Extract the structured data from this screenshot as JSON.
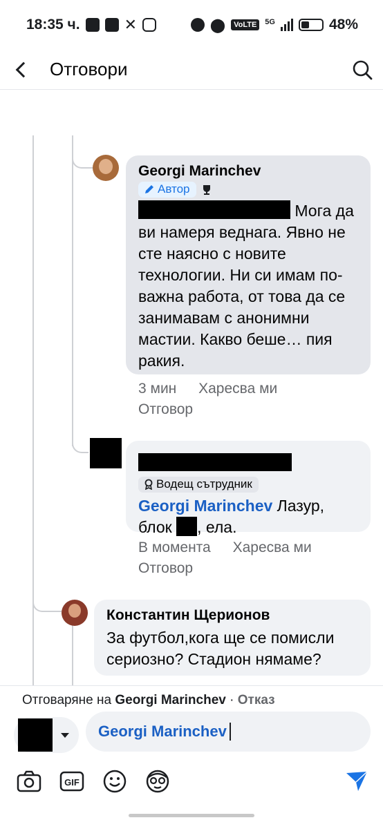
{
  "status_bar": {
    "time": "18:35 ч.",
    "network": "5G",
    "volte": "VoLTE",
    "battery": "48%"
  },
  "header": {
    "title": "Отговори"
  },
  "comments": [
    {
      "author": "Georgi Marinchev",
      "badge": "Автор",
      "text": "Мога да ви намеря веднага. Явно не сте наясно с новите технологии. Ни си имам по-важна работа, от това да се занимавам с анонимни мастии. Какво беше… пия ракия.",
      "time": "3 мин",
      "like": "Харесва ми",
      "reply": "Отговор"
    },
    {
      "badge": "Водещ сътрудник",
      "mention": "Georgi Marinchev",
      "text_before": "Лазур, блок",
      "text_after": ", ела.",
      "time": "В момента",
      "like": "Харесва ми",
      "reply": "Отговор"
    },
    {
      "author": "Константин Щерионов",
      "text": "За футбол,кога ще се помисли сериозно? Стадион нямаме?"
    }
  ],
  "reply_bar": {
    "replying_prefix": "Отговаряне на",
    "replying_to": "Georgi Marinchev",
    "separator": "·",
    "cancel": "Отказ",
    "input_value": "Georgi Marinchev"
  },
  "colors": {
    "accent": "#1b74e4",
    "bubble": "#f0f2f5",
    "meta": "#65676b"
  }
}
